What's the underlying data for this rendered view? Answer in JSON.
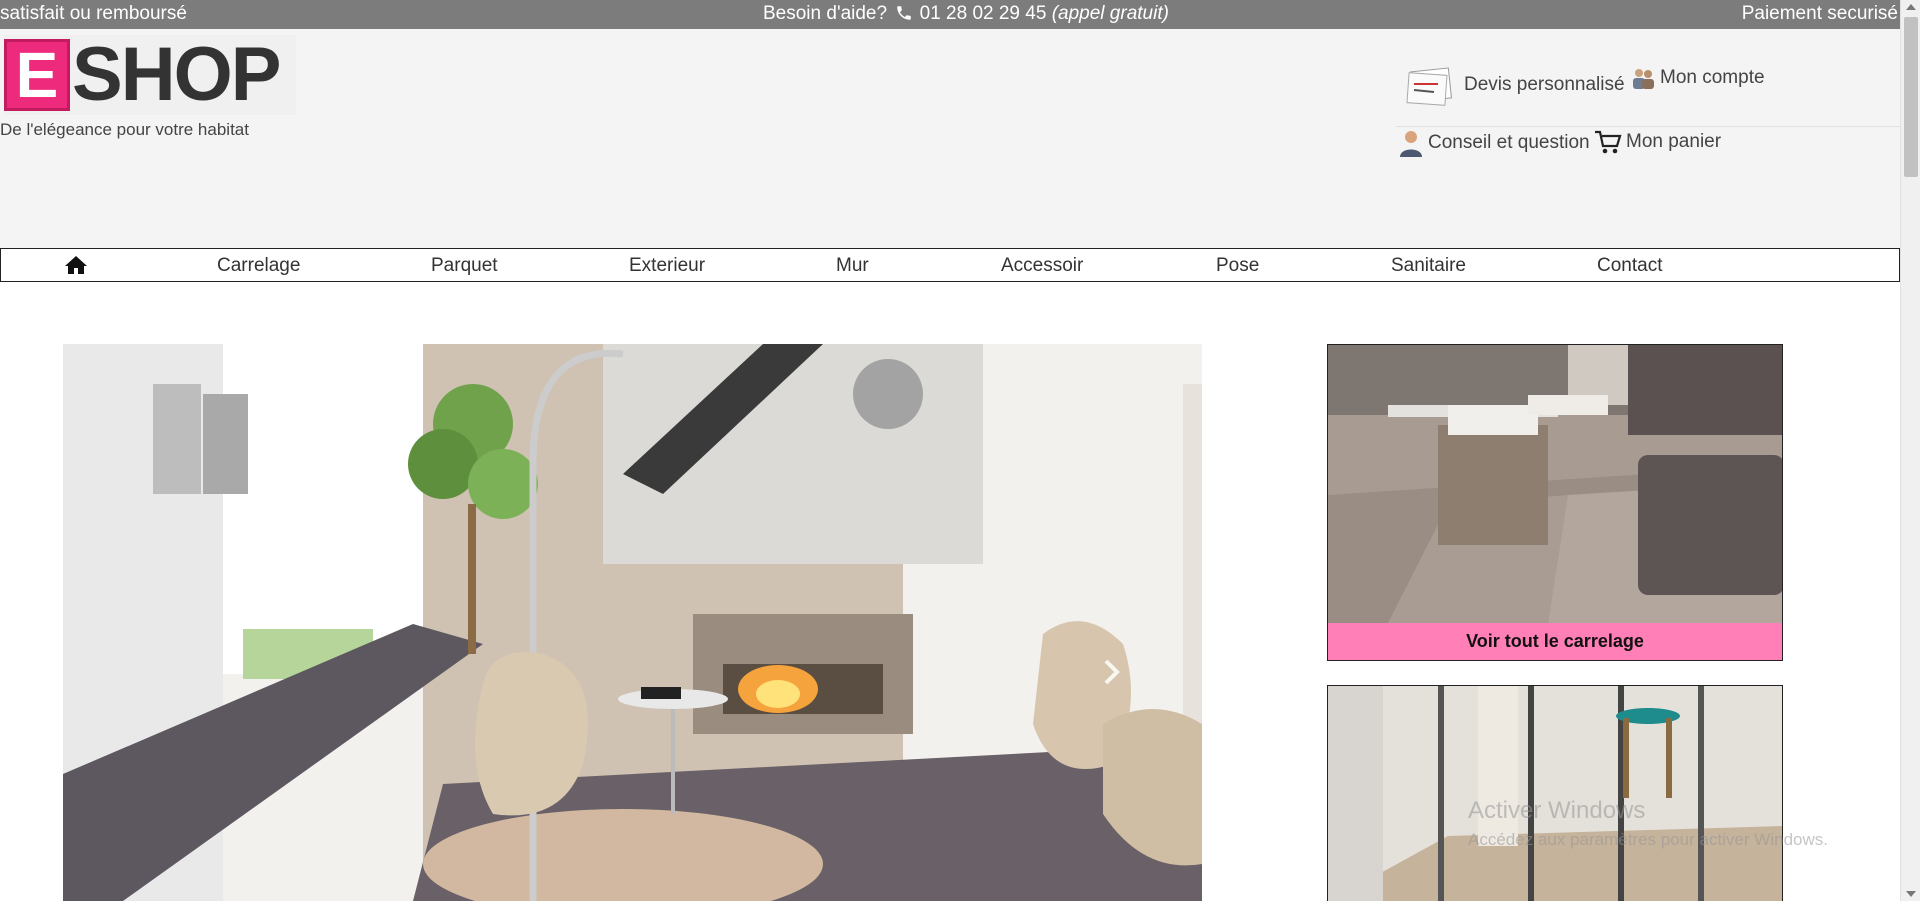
{
  "topbar": {
    "left": "satisfait ou remboursé",
    "help_label": "Besoin d'aide?",
    "phone": "01 28 02 29 45",
    "phone_note": "(appel gratuit)",
    "right": "Paiement securisé"
  },
  "brand": {
    "logo_letter": "E",
    "logo_word": "SHOP",
    "tagline": "De l'elégeance pour votre habitat",
    "accent_color": "#ed2a7b"
  },
  "header_links": {
    "quote": "Devis personnalisé",
    "account": "Mon compte",
    "advice": "Conseil et question",
    "cart": "Mon panier"
  },
  "nav": {
    "home_icon": "home-icon",
    "items": [
      "Carrelage",
      "Parquet",
      "Exterieur",
      "Mur",
      "Accessoir",
      "Pose",
      "Sanitaire",
      "Contact"
    ]
  },
  "cards": [
    {
      "label": "Voir tout le carrelage",
      "label_color": "#ff7fb6"
    }
  ],
  "watermark": {
    "title": "Activer Windows",
    "subtitle": "Accédez aux paramètres pour activer Windows."
  }
}
